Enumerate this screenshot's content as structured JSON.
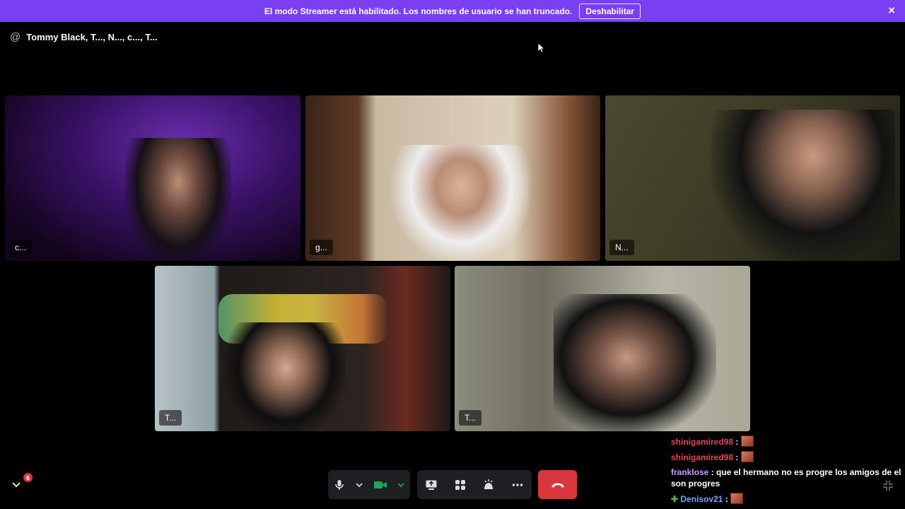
{
  "banner": {
    "message": "El modo Streamer está habilitado. Los nombres de usuario se han truncado.",
    "button_label": "Deshabilitar",
    "close_icon": "×",
    "color": "#7a3ff2"
  },
  "call": {
    "at_symbol": "@",
    "title": "Tommy Black, T..., N..., c..., T..."
  },
  "participants": [
    {
      "label": "c...",
      "speaking": false
    },
    {
      "label": "g...",
      "speaking": false
    },
    {
      "label": "N...",
      "speaking": true
    },
    {
      "label": "T...",
      "speaking": false
    },
    {
      "label": "T...",
      "speaking": false
    }
  ],
  "controls": {
    "icons": [
      "microphone-icon",
      "chevron-down-icon",
      "camera-icon",
      "chevron-down-icon",
      "screen-share-icon",
      "activities-icon",
      "soundboard-icon",
      "more-icon",
      "hang-up-icon"
    ],
    "notification_count": "6",
    "hangup_color": "#da373c",
    "speaking_color": "#23a55a"
  },
  "chat": [
    {
      "user": "shinigamired98",
      "sep": ":",
      "text": "",
      "color": "#e0465a",
      "emote": true
    },
    {
      "user": "shinigamired98",
      "sep": ":",
      "text": "",
      "color": "#e0465a",
      "emote": true
    },
    {
      "user": "franklose",
      "sep": ":",
      "text": "que el hermano no es progre los amigos de el son progres",
      "color": "#c79bff",
      "emote": false
    },
    {
      "user": "Denisov21",
      "sep": ":",
      "text": "",
      "color": "#6fa8ff",
      "emote": true
    }
  ]
}
